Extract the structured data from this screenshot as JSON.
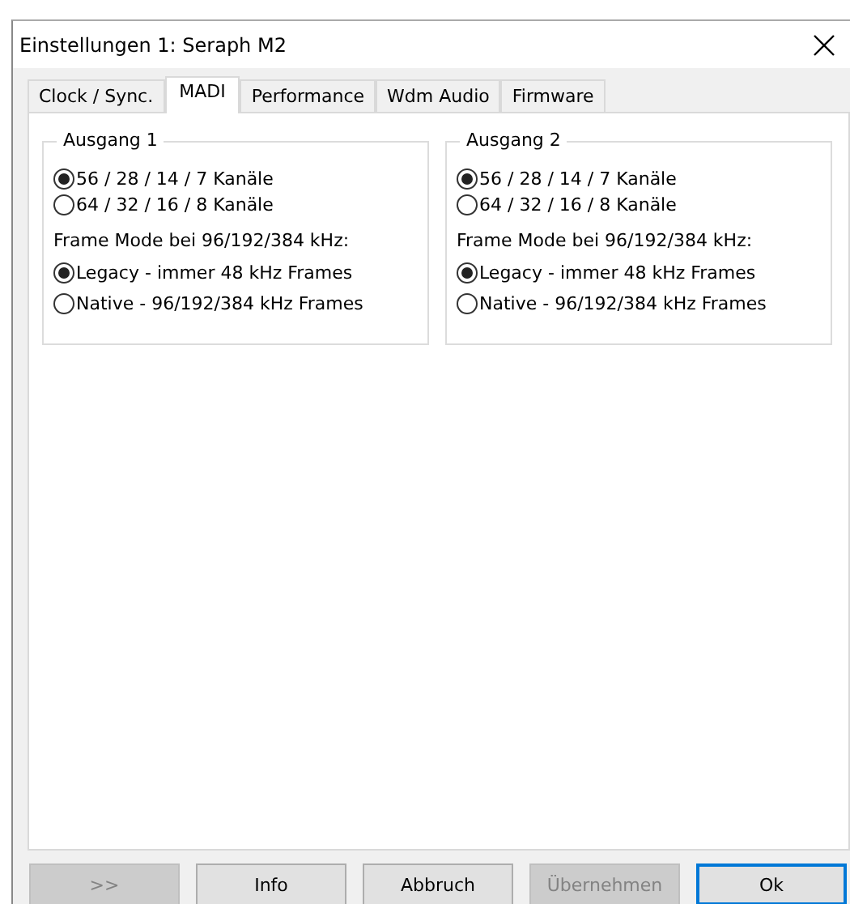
{
  "window": {
    "title": "Einstellungen 1: Seraph M2"
  },
  "tabs": [
    {
      "label": "Clock / Sync.",
      "selected": false
    },
    {
      "label": "MADI",
      "selected": true
    },
    {
      "label": "Performance",
      "selected": false
    },
    {
      "label": "Wdm Audio",
      "selected": false
    },
    {
      "label": "Firmware",
      "selected": false
    }
  ],
  "groups": [
    {
      "legend": "Ausgang 1",
      "channel_options": [
        {
          "label": "56 / 28 / 14 / 7 Kanäle",
          "selected": true
        },
        {
          "label": "64 / 32 / 16 / 8 Kanäle",
          "selected": false
        }
      ],
      "frame_mode_label": "Frame Mode bei 96/192/384 kHz:",
      "frame_options": [
        {
          "label": "Legacy - immer 48 kHz Frames",
          "selected": true
        },
        {
          "label": "Native - 96/192/384 kHz Frames",
          "selected": false
        }
      ]
    },
    {
      "legend": "Ausgang 2",
      "channel_options": [
        {
          "label": "56 / 28 / 14 / 7 Kanäle",
          "selected": true
        },
        {
          "label": "64 / 32 / 16 / 8 Kanäle",
          "selected": false
        }
      ],
      "frame_mode_label": "Frame Mode bei 96/192/384 kHz:",
      "frame_options": [
        {
          "label": "Legacy - immer 48 kHz Frames",
          "selected": true
        },
        {
          "label": "Native - 96/192/384 kHz Frames",
          "selected": false
        }
      ]
    }
  ],
  "buttons": [
    {
      "label": ">>",
      "disabled": true,
      "default": false
    },
    {
      "label": "Info",
      "disabled": false,
      "default": false
    },
    {
      "label": "Abbruch",
      "disabled": false,
      "default": false
    },
    {
      "label": "Übernehmen",
      "disabled": true,
      "default": false
    },
    {
      "label": "Ok",
      "disabled": false,
      "default": true
    }
  ]
}
